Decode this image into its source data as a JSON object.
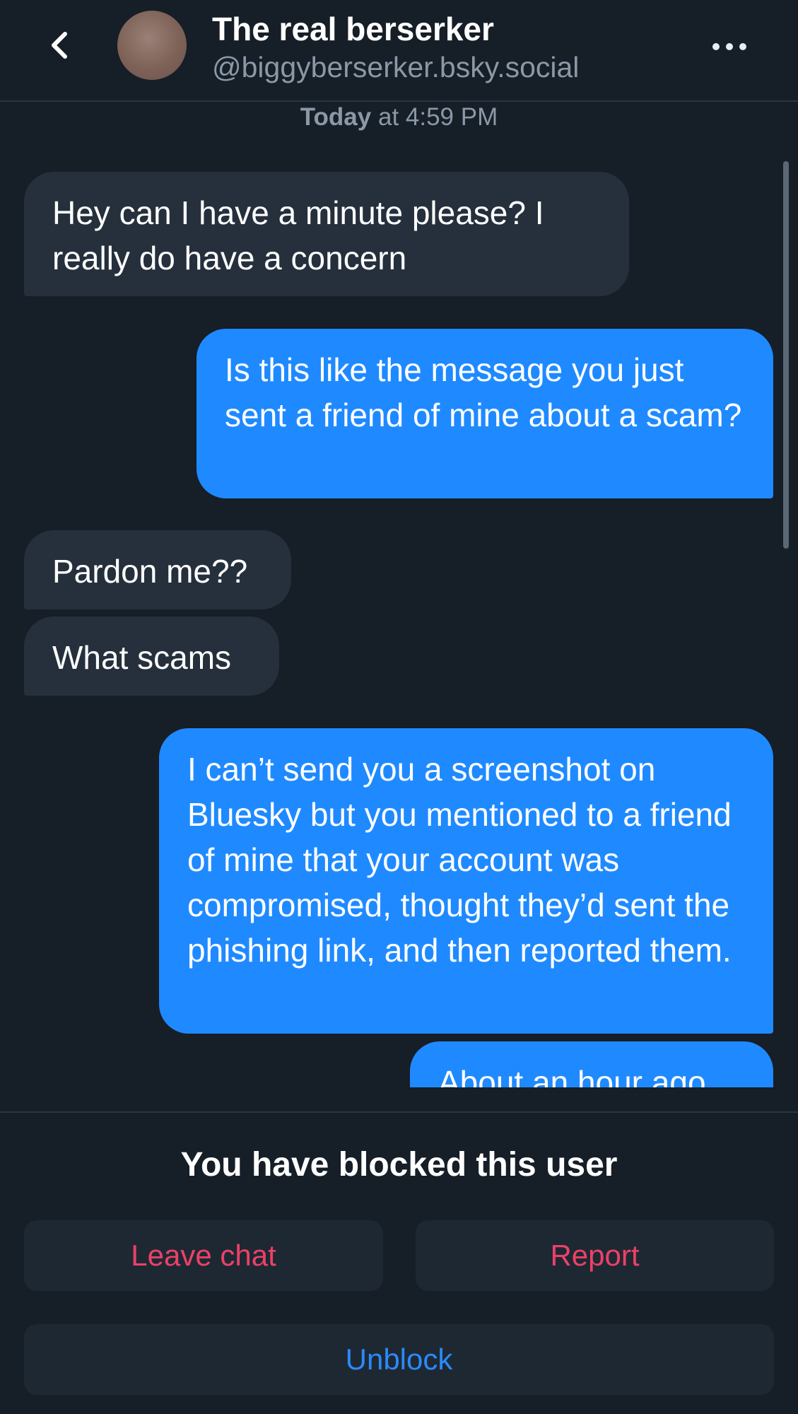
{
  "header": {
    "back_icon": "chevron-left-icon",
    "title": "The real berserker",
    "handle": "@biggyberserker.bsky.social",
    "more_icon": "more-horizontal-icon"
  },
  "timestamp": {
    "day": "Today",
    "time": " at 4:59 PM"
  },
  "messages": [
    {
      "from": "them",
      "text": "Hey can I have a minute please? I really do have a concern"
    },
    {
      "from": "me",
      "text": "Is this like the message you just sent a friend of mine about a scam?"
    },
    {
      "from": "them",
      "text": "Pardon me??"
    },
    {
      "from": "them",
      "text": "What scams"
    },
    {
      "from": "me",
      "text": "I can’t send you a screenshot on Bluesky but you mentioned to a friend of mine that your account was compromised, thought they’d sent the phishing link, and then reported them."
    },
    {
      "from": "me",
      "text": "About an hour ago"
    }
  ],
  "blocked_banner": {
    "text": "You have blocked this user",
    "leave_label": "Leave chat",
    "report_label": "Report",
    "unblock_label": "Unblock"
  },
  "colors": {
    "background": "#161e27",
    "their_bubble": "#25303c",
    "my_bubble": "#1f8aff",
    "danger": "#ec4168",
    "link": "#2a8af8"
  }
}
